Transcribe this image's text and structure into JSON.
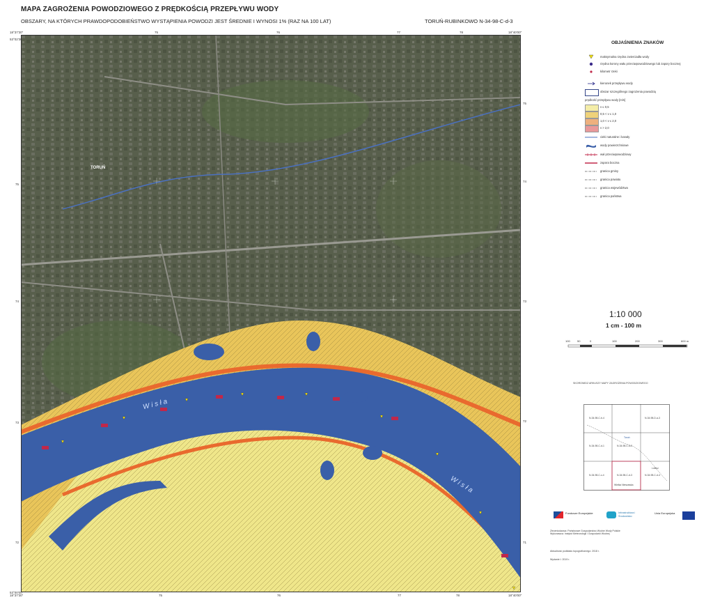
{
  "header": {
    "title": "MAPA ZAGROŻENIA POWODZIOWEGO Z PRĘDKOŚCIĄ PRZEPŁYWU WODY",
    "subtitle": "OBSZARY, NA KTÓRYCH PRAWDOPODOBIEŃSTWO WYSTĄPIENIA POWODZI JEST ŚREDNIE I WYNOSI 1% (RAZ NA 100 LAT)",
    "sheet": "TORUŃ-RUBINKOWO  N-34-98-C-d-3"
  },
  "frame": {
    "top_labels": [
      "18°37'30\"",
      "75",
      "76",
      "77",
      "78",
      "18°40'00\""
    ],
    "bottom_labels": [
      "18°37'30\"",
      "75",
      "76",
      "77",
      "78",
      "18°40'00\""
    ],
    "left_labels": [
      "53°02'30\"",
      "75",
      "74",
      "73",
      "72",
      "53°00'00\""
    ],
    "right_labels": [
      "75",
      "74",
      "73",
      "72",
      "71"
    ]
  },
  "map_labels": {
    "city": "TORUŃ",
    "river1": "W i s ł a",
    "river2": "W i s ł a",
    "colors": {
      "water": "#3a5fa8",
      "flood_low": "#efe68a",
      "flood_mid": "#e9b24a",
      "flood_high": "#e96a2e",
      "aerial": "#5b6048"
    }
  },
  "legend": {
    "title": "OBJAŚNIENIA ZNAKÓW",
    "items": [
      {
        "label": "maksymalna rzędna zwierciadła wody",
        "icon": "triangle-marker-icon"
      },
      {
        "label": "rzędna korony wału przeciwpowodziowego lub zapory bocznej",
        "icon": "dot-marker-icon"
      },
      {
        "label": "kilometr rzeki",
        "icon": "km-marker-icon"
      },
      {
        "label": "kierunek przepływu wody",
        "icon": "flow-arrow-icon"
      },
      {
        "label": "obszar szczególnego zagrożenia powodzią",
        "icon": "hazard-area-icon"
      },
      {
        "label": "prędkość przepływu wody [m/s]",
        "icon": "none"
      },
      {
        "label": "v ≤ 0,5",
        "icon": "swatch-icon",
        "color": "#f4eda8"
      },
      {
        "label": "0,5 < v ≤ 1,0",
        "icon": "swatch-icon",
        "color": "#efd27a"
      },
      {
        "label": "1,0 < v ≤ 2,0",
        "icon": "swatch-icon",
        "color": "#eeb07e"
      },
      {
        "label": "v > 2,0",
        "icon": "swatch-icon",
        "color": "#e9999a"
      },
      {
        "label": "cieki naturalne i kanały",
        "icon": "river-line-icon"
      },
      {
        "label": "wody powierzchniowe",
        "icon": "water-area-icon"
      },
      {
        "label": "wał przeciwpowodziowy",
        "icon": "levee-icon"
      },
      {
        "label": "zapora boczna",
        "icon": "dam-icon"
      },
      {
        "label": "granica gminy",
        "icon": "boundary-icon"
      },
      {
        "label": "granica powiatu",
        "icon": "boundary-icon"
      },
      {
        "label": "granica województwa",
        "icon": "boundary-icon"
      },
      {
        "label": "granica państwa",
        "icon": "boundary-icon"
      }
    ]
  },
  "scale": {
    "ratio": "1:10 000",
    "text": "1 cm - 100 m",
    "bar_labels": [
      "100",
      "50",
      "0",
      "100",
      "200",
      "300",
      "400",
      "500",
      "600 m"
    ]
  },
  "index_map": {
    "title": "SKOROWIDZ ARKUSZY MAPY ZAGROŻENIA POWODZIOWEGO",
    "cells": [
      "N-34-98-C-b-4",
      "N-34-98-D-a-3",
      "N-34-98-C-d-1",
      "N-34-98-C-d-2",
      "N-34-98-C-d-3",
      "N-34-98-C-d-4",
      "N-34-98-C-c-4"
    ],
    "places": [
      "Toruń",
      "Lubicz",
      "Wielka Nieszawka"
    ]
  },
  "logos": {
    "funds": "Fundusze Europejskie",
    "program": "Infrastruktura i Środowisko",
    "eu": "Unia Europejska"
  },
  "credits": [
    "Zleceniodawca: Państwowe Gospodarstwo Wodne Wody Polskie",
    "Wykonawca: Instytut Meteorologii i Gospodarki Wodnej",
    "Aktualność podkładu topograficznego: 2018 r.",
    "Wydanie I: 2019 r."
  ]
}
